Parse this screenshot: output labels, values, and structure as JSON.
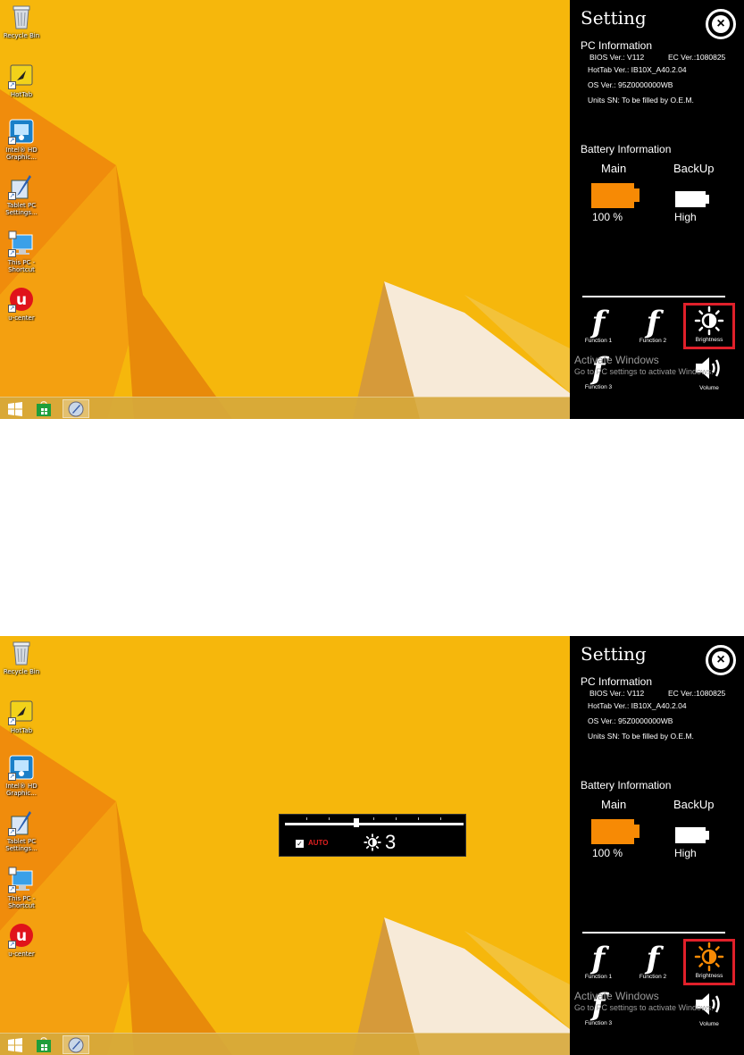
{
  "screenshots": [
    {
      "desktop_icons": [
        {
          "label": "Recycle Bin",
          "icon": "recycle-bin-icon"
        },
        {
          "label": "HotTab",
          "icon": "hottab-icon"
        },
        {
          "label": "Intel® HD\nGraphic...",
          "icon": "intel-graphics-icon"
        },
        {
          "label": "Tablet PC\nSettings...",
          "icon": "tablet-pc-settings-icon"
        },
        {
          "label": "This PC -\nShortcut",
          "icon": "this-pc-icon"
        },
        {
          "label": "u-center",
          "icon": "u-center-icon"
        }
      ],
      "panel": {
        "title": "Setting",
        "pc_info_title": "PC Information",
        "bios": "BIOS Ver.: V112",
        "ec": "EC Ver.:1080825",
        "hottab": "HotTab Ver.: IB10X_A40.2.04",
        "os": "OS Ver.: 95Z0000000WB",
        "units_sn": "Units SN: To be filled by O.E.M.",
        "battery_title": "Battery Information",
        "main_label": "Main",
        "backup_label": "BackUp",
        "main_value": "100 %",
        "backup_value": "High",
        "function1": "Function 1",
        "function2": "Function 2",
        "function3": "Function 3",
        "brightness": "Brightness",
        "volume": "Volume",
        "brightness_icon_color": "#ffffff"
      },
      "activate": {
        "line1": "Activate Windows",
        "line2": "Go to PC settings to activate Windows."
      }
    },
    {
      "desktop_icons": [
        {
          "label": "Recycle Bin",
          "icon": "recycle-bin-icon"
        },
        {
          "label": "HotTab",
          "icon": "hottab-icon"
        },
        {
          "label": "Intel® HD\nGraphic...",
          "icon": "intel-graphics-icon"
        },
        {
          "label": "Tablet PC\nSettings...",
          "icon": "tablet-pc-settings-icon"
        },
        {
          "label": "This PC -\nShortcut",
          "icon": "this-pc-icon"
        },
        {
          "label": "u-center",
          "icon": "u-center-icon"
        }
      ],
      "panel": {
        "title": "Setting",
        "pc_info_title": "PC Information",
        "bios": "BIOS Ver.: V112",
        "ec": "EC Ver.:1080825",
        "hottab": "HotTab Ver.: IB10X_A40.2.04",
        "os": "OS Ver.: 95Z0000000WB",
        "units_sn": "Units SN: To be filled by O.E.M.",
        "battery_title": "Battery Information",
        "main_label": "Main",
        "backup_label": "BackUp",
        "main_value": "100 %",
        "backup_value": "High",
        "function1": "Function 1",
        "function2": "Function 2",
        "function3": "Function 3",
        "brightness": "Brightness",
        "volume": "Volume",
        "brightness_icon_color": "#f78a05"
      },
      "activate": {
        "line1": "Activate Windows",
        "line2": "Go to PC settings to activate Windows."
      },
      "brightness_popup": {
        "auto_label": "AUTO",
        "level": "3",
        "slider_fraction": 0.4,
        "auto_checked": true
      }
    }
  ],
  "colors": {
    "wallpaper": "#f6b70c",
    "panel_bg": "#000000",
    "battery_main": "#f78a05",
    "highlight_box": "#e0202a",
    "auto_text": "#e02020"
  }
}
